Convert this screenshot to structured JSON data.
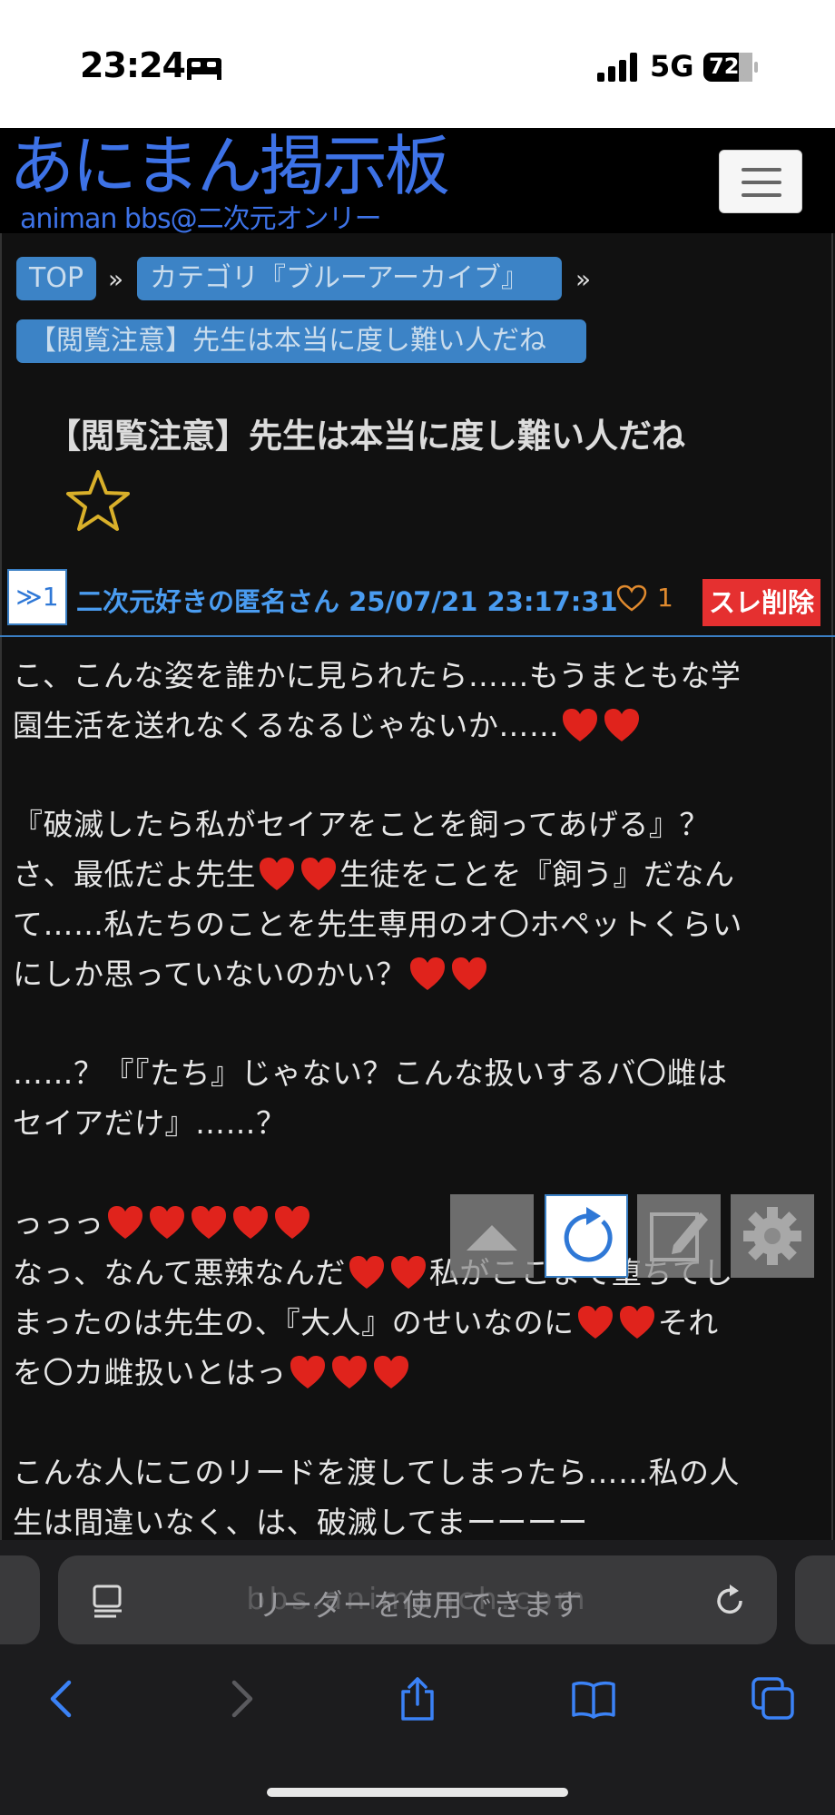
{
  "status_bar": {
    "time": "23:24",
    "network": "5G",
    "battery": "72",
    "icons": [
      "bed-icon",
      "signal-icon",
      "battery-icon"
    ]
  },
  "site": {
    "title": "あにまん掲示板",
    "subtitle": "animan bbs@二次元オンリー",
    "title_color": "#3d72e6",
    "menu_icon": "hamburger-icon"
  },
  "breadcrumb": {
    "items": [
      "TOP",
      "カテゴリ『ブルーアーカイブ』",
      "【閲覧注意】先生は本当に度し難い人だね"
    ],
    "separator": "»",
    "color": "#3c83c6"
  },
  "thread": {
    "title": "【閲覧注意】先生は本当に度し難い人だね",
    "favorite_icon": "star-icon"
  },
  "post": {
    "anchor": "≫1",
    "author": "二次元好きの匿名さん",
    "datetime": "25/07/21 23:17:31",
    "likes": "1",
    "delete_label": "スレ削除",
    "body": [
      "こ、こんな姿を誰かに見られたら……もうまともな学",
      "園生活を送れなくるなるじゃないか……",
      "『破滅したら私がセイアをことを飼ってあげる』？",
      "さ、最低だよ先生",
      "生徒をことを『飼う』だなん",
      "て……私たちのことを先生専用のオ〇ホペットくらい",
      "にしか思っていないのかい？",
      "……？『『たち』じゃない？こんな扱いするバ〇雌は",
      "セイアだけ』……？",
      "っっっ",
      "なっ、なんて悪辣なんだ",
      "私がここまで堕ちてし",
      "まったのは先生の、『大人』のせいなのに",
      "それ",
      "を〇カ雌扱いとはっ",
      "こんな人にこのリードを渡してしまったら……私の人",
      "生は間違いなく、は、破滅してまーーーー"
    ]
  },
  "floating_buttons": [
    "scroll-up-icon",
    "reload-icon",
    "edit-icon",
    "gear-icon"
  ],
  "browser": {
    "url_text": "リーダーを使用できます",
    "url_ghost": "bbs.animanch.com",
    "toolbar": [
      "back-icon",
      "forward-icon",
      "share-icon",
      "bookmarks-icon",
      "tabs-icon"
    ],
    "accent": "#3b82f6"
  }
}
